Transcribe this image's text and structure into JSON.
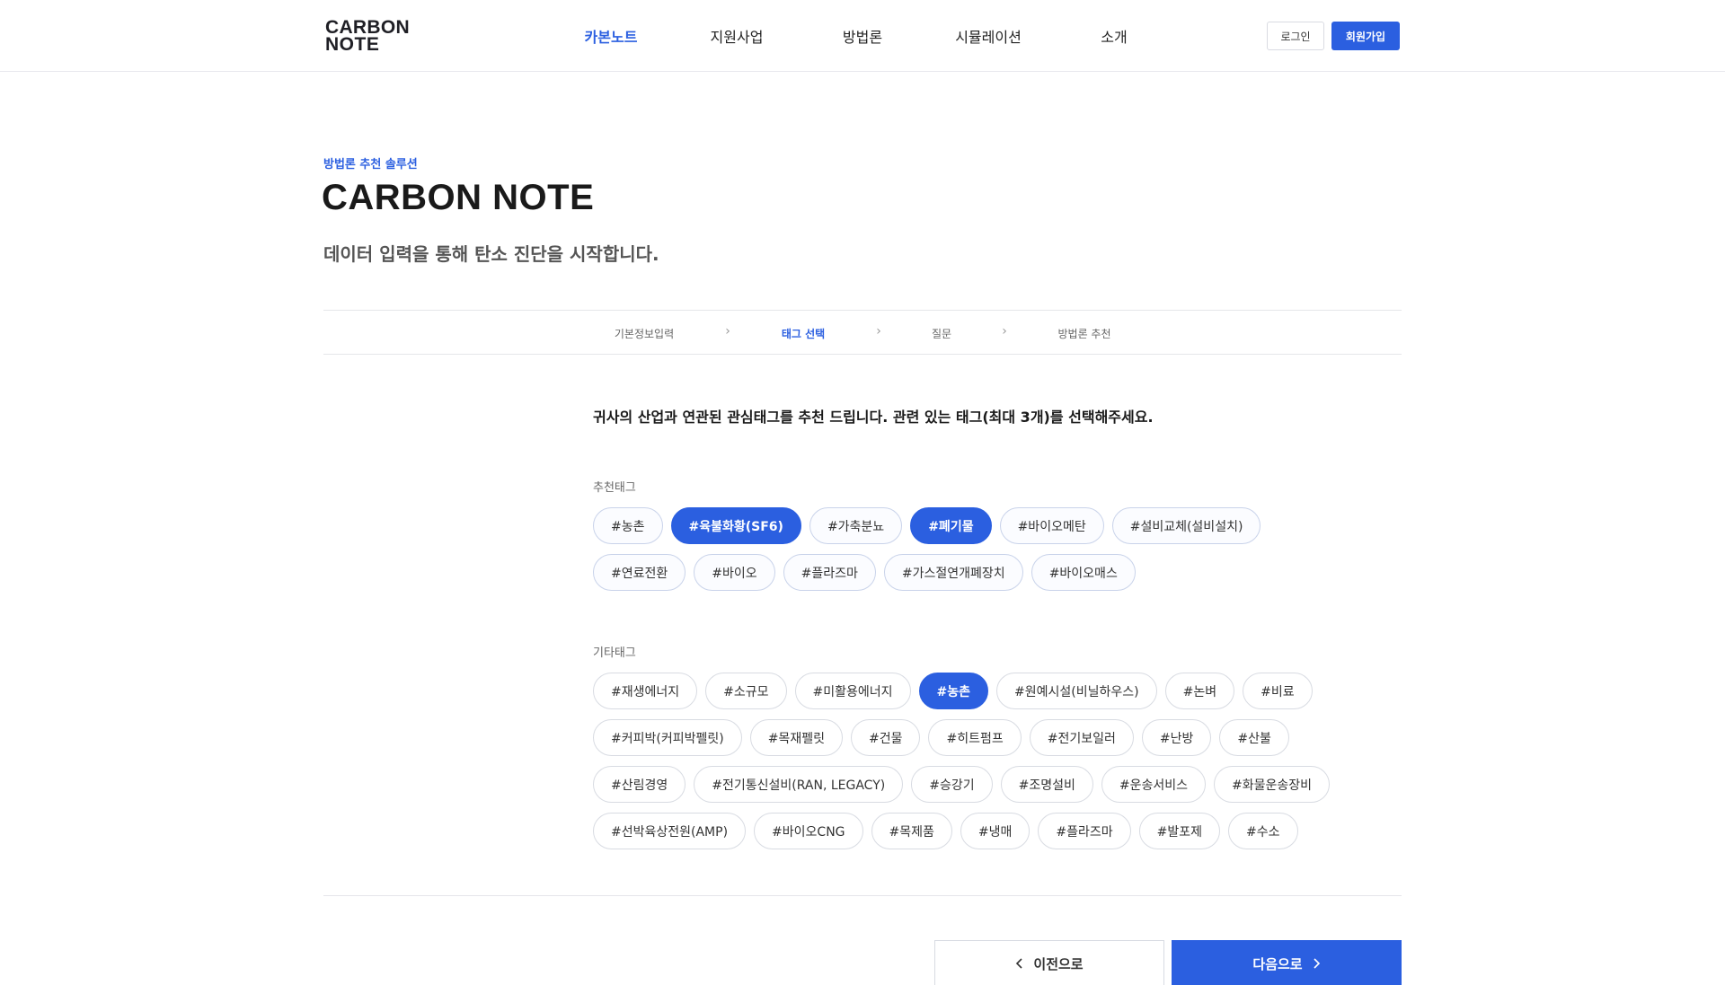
{
  "header": {
    "logo_line1": "CARBON",
    "logo_line2": "NOTE",
    "nav": [
      {
        "label": "카본노트",
        "active": true
      },
      {
        "label": "지원사업",
        "active": false
      },
      {
        "label": "방법론",
        "active": false
      },
      {
        "label": "시뮬레이션",
        "active": false
      },
      {
        "label": "소개",
        "active": false
      }
    ],
    "login_label": "로그인",
    "signup_label": "회원가입"
  },
  "hero": {
    "eyebrow": "방법론 추천 솔루션",
    "title": "CARBON NOTE",
    "subtitle": "데이터 입력을 통해 탄소 진단을 시작합니다."
  },
  "stepper": {
    "steps": [
      {
        "label": "기본정보입력",
        "active": false
      },
      {
        "label": "태그 선택",
        "active": true
      },
      {
        "label": "질문",
        "active": false
      },
      {
        "label": "방법론 추천",
        "active": false
      }
    ]
  },
  "main": {
    "instruction": "귀사의 산업과 연관된 관심태그를 추천 드립니다.  관련 있는 태그(최대 3개)를 선택해주세요.",
    "recommended_label": "추천태그",
    "recommended_tags": [
      {
        "label": "#농촌",
        "selected": false
      },
      {
        "label": "#육불화황(SF6)",
        "selected": true
      },
      {
        "label": "#가축분뇨",
        "selected": false
      },
      {
        "label": "#폐기물",
        "selected": true
      },
      {
        "label": "#바이오메탄",
        "selected": false
      },
      {
        "label": "#설비교체(설비설치)",
        "selected": false
      },
      {
        "label": "#연료전환",
        "selected": false
      },
      {
        "label": "#바이오",
        "selected": false
      },
      {
        "label": "#플라즈마",
        "selected": false
      },
      {
        "label": "#가스절연개폐장치",
        "selected": false
      },
      {
        "label": "#바이오매스",
        "selected": false
      }
    ],
    "other_label": "기타태그",
    "other_tags": [
      {
        "label": "#재생에너지",
        "selected": false
      },
      {
        "label": "#소규모",
        "selected": false
      },
      {
        "label": "#미활용에너지",
        "selected": false
      },
      {
        "label": "#농촌",
        "selected": true
      },
      {
        "label": "#원예시설(비닐하우스)",
        "selected": false
      },
      {
        "label": "#논벼",
        "selected": false
      },
      {
        "label": "#비료",
        "selected": false
      },
      {
        "label": "#커피박(커피박펠릿)",
        "selected": false
      },
      {
        "label": "#목재펠릿",
        "selected": false
      },
      {
        "label": "#건물",
        "selected": false
      },
      {
        "label": "#히트펌프",
        "selected": false
      },
      {
        "label": "#전기보일러",
        "selected": false
      },
      {
        "label": "#난방",
        "selected": false
      },
      {
        "label": "#산불",
        "selected": false
      },
      {
        "label": "#산림경영",
        "selected": false
      },
      {
        "label": "#전기통신설비(RAN, LEGACY)",
        "selected": false
      },
      {
        "label": "#승강기",
        "selected": false
      },
      {
        "label": "#조명설비",
        "selected": false
      },
      {
        "label": "#운송서비스",
        "selected": false
      },
      {
        "label": "#화물운송장비",
        "selected": false
      },
      {
        "label": "#선박육상전원(AMP)",
        "selected": false
      },
      {
        "label": "#바이오CNG",
        "selected": false
      },
      {
        "label": "#목제품",
        "selected": false
      },
      {
        "label": "#냉매",
        "selected": false
      },
      {
        "label": "#플라즈마",
        "selected": false
      },
      {
        "label": "#발포제",
        "selected": false
      },
      {
        "label": "#수소",
        "selected": false
      }
    ]
  },
  "footer_buttons": {
    "prev_label": "이전으로",
    "next_label": "다음으로"
  },
  "colors": {
    "accent": "#2b5fe0",
    "border": "#e5e6ea"
  }
}
